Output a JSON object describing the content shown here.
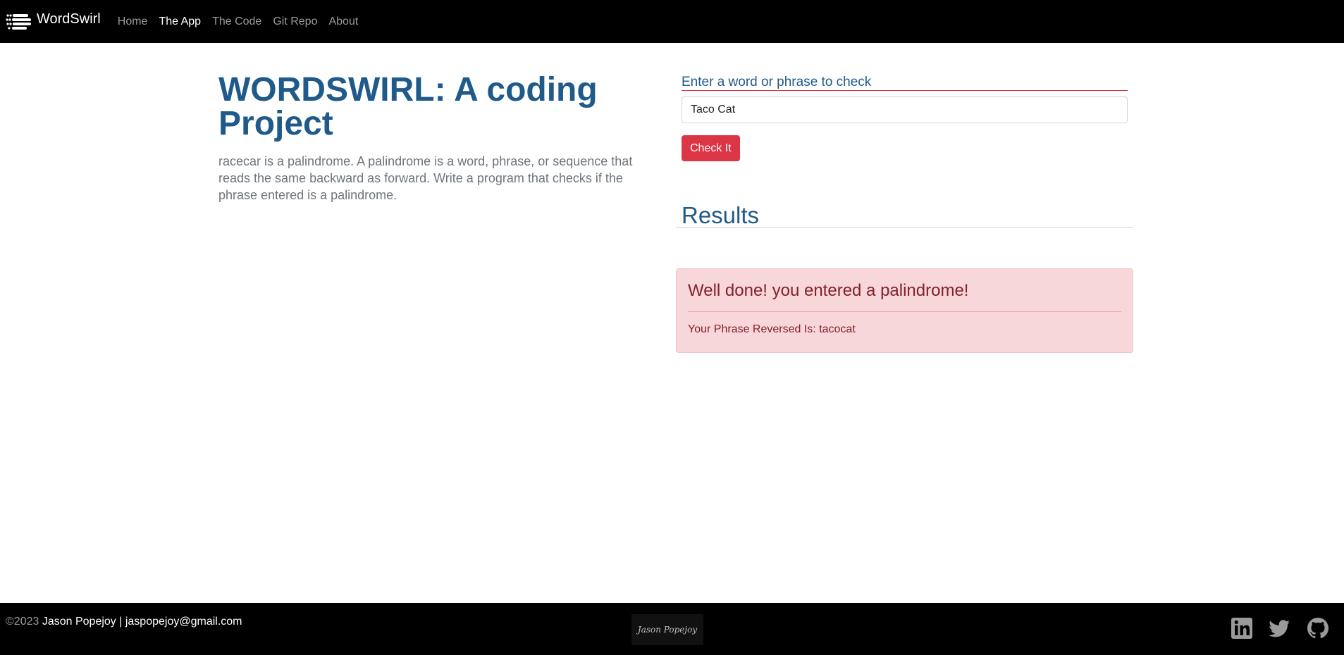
{
  "navbar": {
    "brand": "WordSwirl",
    "links": [
      {
        "label": "Home",
        "active": false
      },
      {
        "label": "The App",
        "active": true
      },
      {
        "label": "The Code",
        "active": false
      },
      {
        "label": "Git Repo",
        "active": false
      },
      {
        "label": "About",
        "active": false
      }
    ]
  },
  "hero": {
    "title": "WORDSWIRL: A coding Project",
    "description": "racecar is a palindrome. A palindrome is a word, phrase, or sequence that reads the same backward as forward. Write a program that checks if the phrase entered is a palindrome."
  },
  "form": {
    "label": "Enter a word or phrase to check",
    "input_value": "Taco Cat",
    "button_label": "Check It"
  },
  "results": {
    "heading": "Results",
    "alert_heading": "Well done! you entered a palindrome!",
    "alert_body": "Your Phrase Reversed Is: tacocat"
  },
  "footer": {
    "copyright": "©2023",
    "contact": "Jason Popejoy | jaspopejoy@gmail.com",
    "signature": "Jason Popejoy",
    "social_icons": [
      "linkedin-icon",
      "twitter-icon",
      "github-icon"
    ]
  },
  "colors": {
    "accent_blue": "#1f5a8a",
    "danger": "#dc3545",
    "alert_bg": "#f8d7da",
    "alert_text": "#842029"
  }
}
